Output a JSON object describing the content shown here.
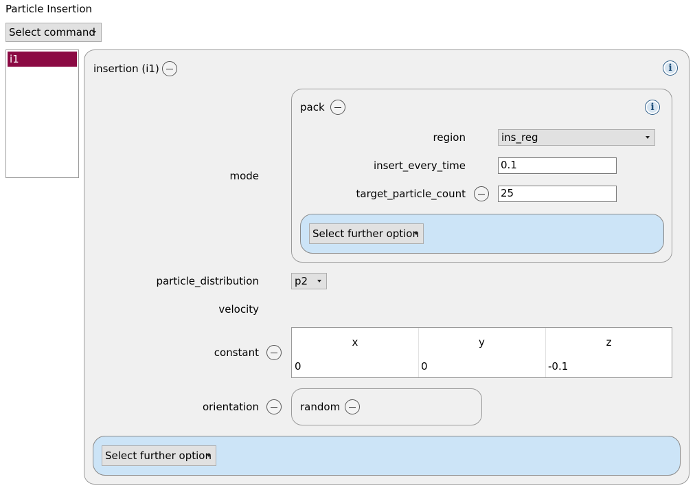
{
  "page": {
    "title": "Particle Insertion"
  },
  "command_select": {
    "label": "Select command"
  },
  "insertions_list": {
    "items": [
      "i1"
    ]
  },
  "insertion": {
    "title": "insertion (i1)",
    "mode_label": "mode",
    "pack": {
      "title": "pack",
      "region": {
        "label": "region",
        "value": "ins_reg"
      },
      "insert_every_time": {
        "label": "insert_every_time",
        "value": "0.1"
      },
      "target_particle_count": {
        "label": "target_particle_count",
        "value": "25"
      },
      "further_option_label": "Select further option"
    },
    "particle_distribution": {
      "label": "particle_distribution",
      "value": "p2"
    },
    "velocity_label": "velocity",
    "constant": {
      "label": "constant",
      "columns": [
        "x",
        "y",
        "z"
      ],
      "values": [
        "0",
        "0",
        "-0.1"
      ]
    },
    "orientation": {
      "label": "orientation",
      "value": "random"
    },
    "further_option_label": "Select further option"
  },
  "icons": {
    "info": "info-icon",
    "remove": "minus-circle-icon",
    "dropdown": "chevron-down-icon"
  },
  "colors": {
    "selection": "#8b0a43",
    "option_panel": "#cce4f7",
    "panel": "#f0f0f0",
    "info_icon": "#1f4f7a"
  }
}
